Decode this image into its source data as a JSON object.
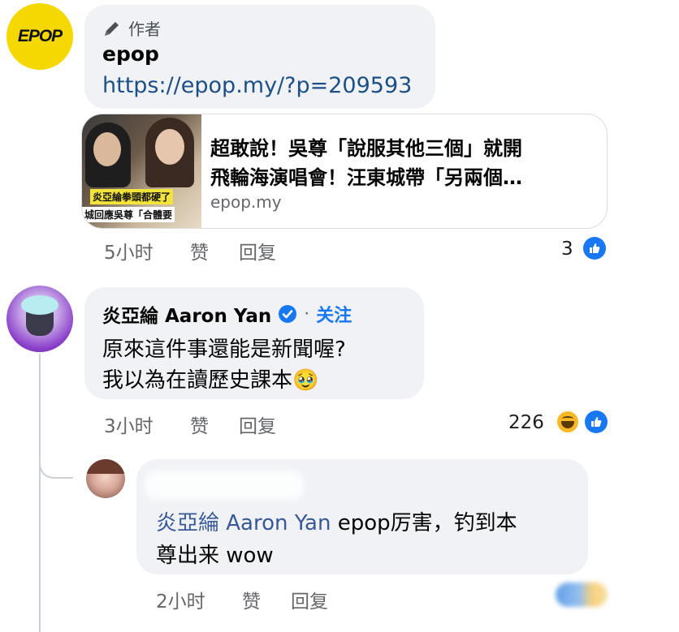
{
  "post": {
    "author_label": "作者",
    "author_name": "epop",
    "link_text": "https://epop.my/?p=209593",
    "logo_text": "EPOP",
    "preview": {
      "title_line1": "超敢說！吳尊「說服其他三個」就開",
      "title_line2": "飛輪海演唱會！汪東城帶「另兩個…",
      "domain": "epop.my",
      "thumb_caption1": "炎亞綸拳頭都硬了",
      "thumb_caption2": "城回應吳尊「合體要"
    },
    "time": "5小时",
    "like_label": "赞",
    "reply_label": "回复",
    "reaction_count": "3"
  },
  "comment1": {
    "name": "炎亞綸 Aaron Yan",
    "follow_sep": "·",
    "follow_label": "关注",
    "line1": "原來這件事還能是新聞喔?",
    "line2": "我以為在讀歷史課本",
    "emoji": "🥹",
    "time": "3小时",
    "like_label": "赞",
    "reply_label": "回复",
    "reaction_count": "226"
  },
  "reply": {
    "mention": "炎亞綸 Aaron Yan",
    "text_part1": " epop厉害，钓到本",
    "text_line2": "尊出来 wow",
    "time": "2小时",
    "like_label": "赞",
    "reply_label": "回复"
  },
  "colors": {
    "link": "#1c4f86",
    "verified": "#1877f2",
    "follow": "#1877f2",
    "mention": "#385898",
    "logo_bg": "#f5d800"
  }
}
